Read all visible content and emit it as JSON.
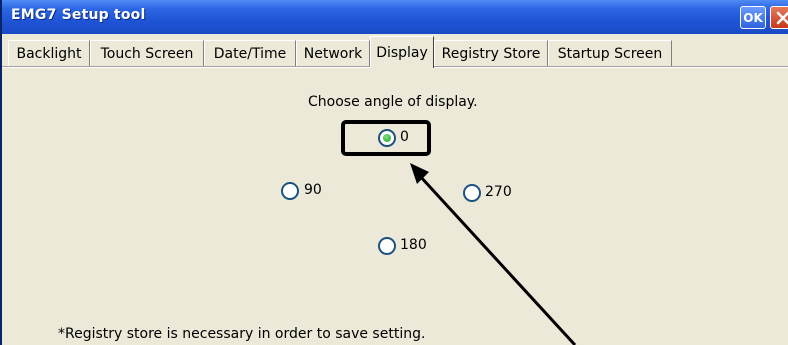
{
  "window": {
    "title": "EMG7 Setup tool",
    "ok_label": "OK",
    "close_icon": "close-icon"
  },
  "tabs": [
    {
      "label": "Backlight",
      "active": false
    },
    {
      "label": "Touch Screen",
      "active": false
    },
    {
      "label": "Date/Time",
      "active": false
    },
    {
      "label": "Network",
      "active": false
    },
    {
      "label": "Display",
      "active": true
    },
    {
      "label": "Registry Store",
      "active": false
    },
    {
      "label": "Startup Screen",
      "active": false
    }
  ],
  "display": {
    "prompt": "Choose angle of display.",
    "options": [
      {
        "label": "0",
        "selected": true
      },
      {
        "label": "90",
        "selected": false
      },
      {
        "label": "270",
        "selected": false
      },
      {
        "label": "180",
        "selected": false
      }
    ],
    "note": "*Registry store is necessary in order to save setting."
  },
  "colors": {
    "titlebar": "#2d67e3",
    "panel": "#ece9d8",
    "radio_selected": "#21a121",
    "annotation": "#000000"
  }
}
